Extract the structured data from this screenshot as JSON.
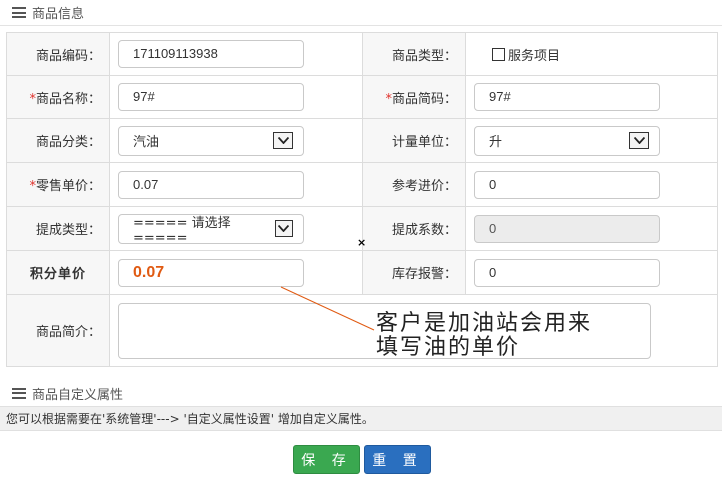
{
  "section1": {
    "title": "商品信息"
  },
  "section2": {
    "title": "商品自定义属性"
  },
  "fields": {
    "code": {
      "label": "商品编码：",
      "value": "171109113938"
    },
    "type": {
      "label": "商品类型：",
      "checkbox_label": "服务项目",
      "checked": false
    },
    "name": {
      "required": "*",
      "label": "商品名称：",
      "value": "97#"
    },
    "short": {
      "required": "*",
      "label": "商品简码：",
      "value": "97#"
    },
    "category": {
      "label": "商品分类：",
      "value": "汽油"
    },
    "unit": {
      "label": "计量单位：",
      "value": "升"
    },
    "price": {
      "required": "*",
      "label": "零售单价：",
      "value": "0.07"
    },
    "ref_price": {
      "label": "参考进价：",
      "value": "0"
    },
    "commission_type": {
      "label": "提成类型：",
      "value": "===== 请选择 ====="
    },
    "commission_rate": {
      "label": "提成系数：",
      "value": "0"
    },
    "points_price": {
      "label": "积分单价",
      "value": "0.07"
    },
    "stock_alarm": {
      "label": "库存报警：",
      "value": "0"
    },
    "description": {
      "label": "商品简介：",
      "value": ""
    }
  },
  "notice": "您可以根据需要在'系统管理'---> '自定义属性设置' 增加自定义属性。",
  "buttons": {
    "save": "保 存",
    "reset": "重 置"
  },
  "annotation": {
    "line1": "客户是加油站会用来",
    "line2": "填写油的单价"
  },
  "marker": "×",
  "colors": {
    "accent_orange": "#e05a12",
    "save_green": "#3aa850",
    "reset_blue": "#2a6fbf",
    "required_red": "#e0312b"
  }
}
